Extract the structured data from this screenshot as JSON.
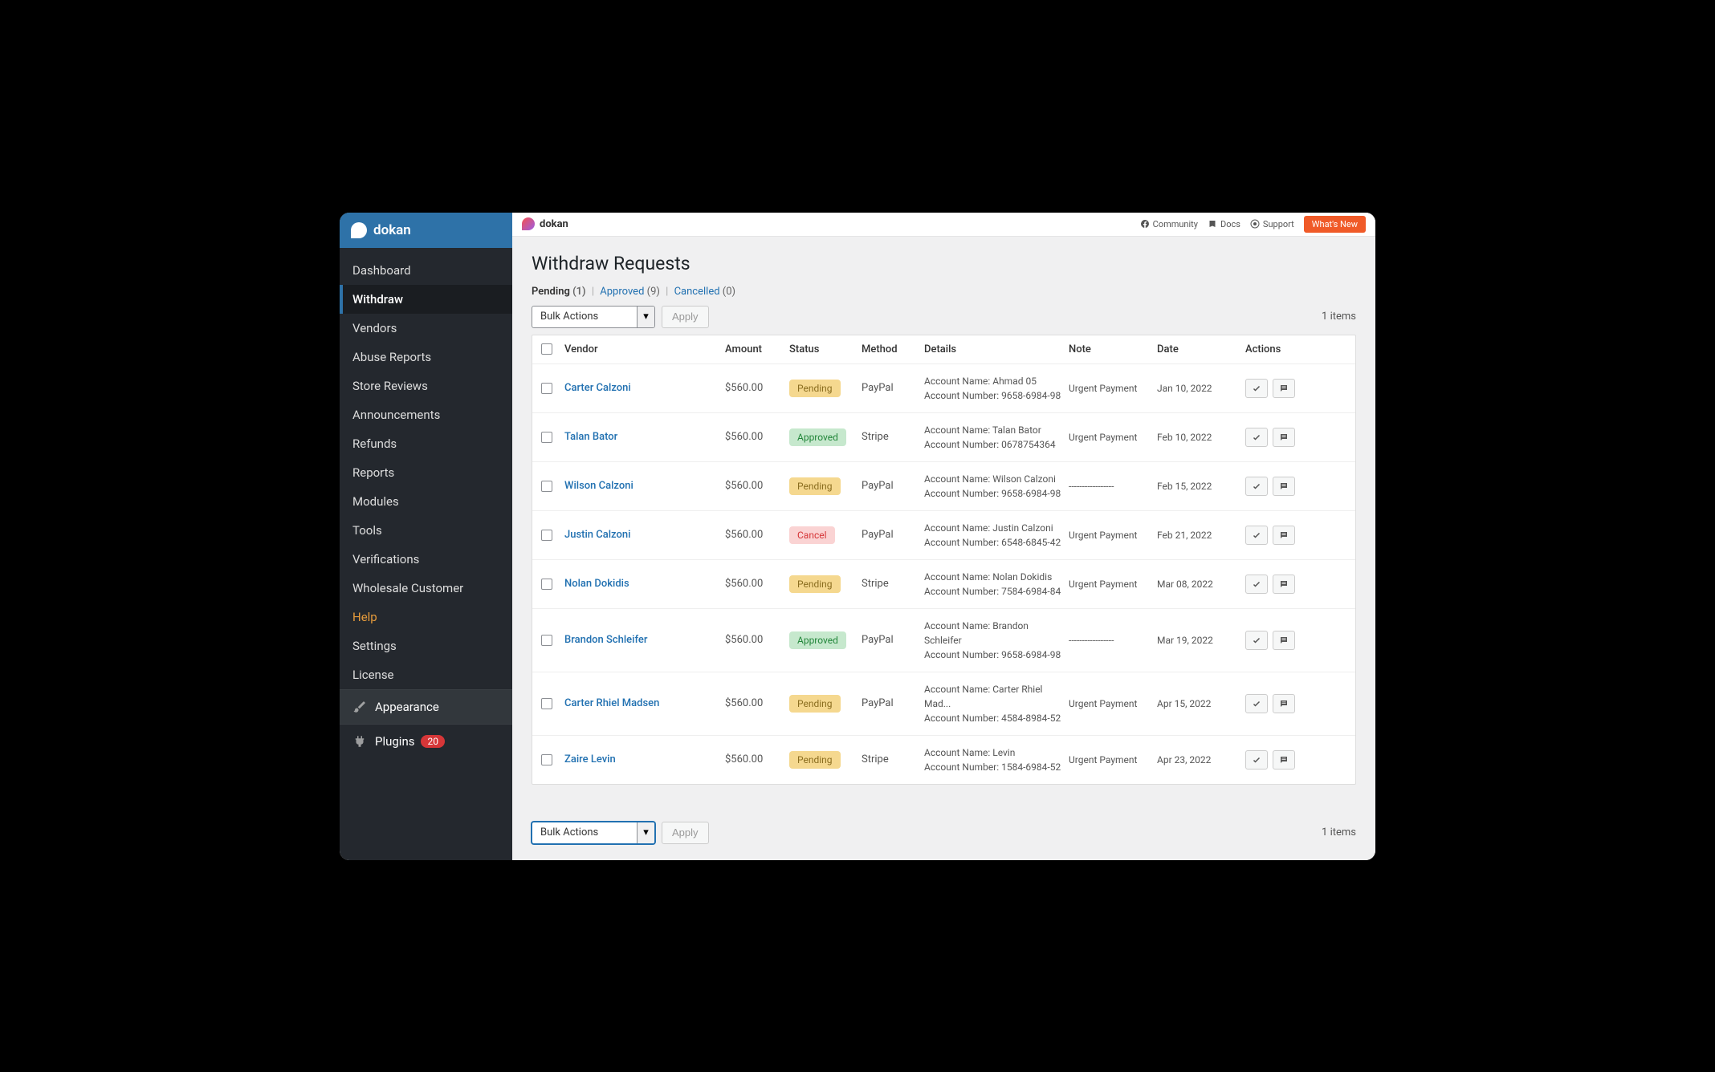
{
  "brand": "dokan",
  "sidebar": {
    "items": [
      {
        "label": "Dashboard"
      },
      {
        "label": "Withdraw"
      },
      {
        "label": "Vendors"
      },
      {
        "label": "Abuse Reports"
      },
      {
        "label": "Store Reviews"
      },
      {
        "label": "Announcements"
      },
      {
        "label": "Refunds"
      },
      {
        "label": "Reports"
      },
      {
        "label": "Modules"
      },
      {
        "label": "Tools"
      },
      {
        "label": "Verifications"
      },
      {
        "label": "Wholesale Customer"
      },
      {
        "label": "Help"
      },
      {
        "label": "Settings"
      },
      {
        "label": "License"
      }
    ],
    "appearance": "Appearance",
    "plugins": "Plugins",
    "plugins_count": "20"
  },
  "topbar": {
    "brand": "dokan",
    "community": "Community",
    "docs": "Docs",
    "support": "Support",
    "whats_new": "What's New"
  },
  "page": {
    "title": "Withdraw Requests",
    "tabs": {
      "pending": "Pending",
      "pending_count": "(1)",
      "approved": "Approved",
      "approved_count": "(9)",
      "cancelled": "Cancelled",
      "cancelled_count": "(0)"
    },
    "bulk_label": "Bulk Actions",
    "apply": "Apply",
    "items_count": "1 items"
  },
  "columns": {
    "vendor": "Vendor",
    "amount": "Amount",
    "status": "Status",
    "method": "Method",
    "details": "Details",
    "note": "Note",
    "date": "Date",
    "actions": "Actions"
  },
  "rows": [
    {
      "vendor": "Carter Calzoni",
      "amount": "$560.00",
      "status": "Pending",
      "status_class": "pending",
      "method": "PayPal",
      "acct_name": "Account Name: Ahmad 05",
      "acct_num": "Account Number: 9658-6984-98",
      "note": "Urgent Payment",
      "date": "Jan 10, 2022"
    },
    {
      "vendor": "Talan Bator",
      "amount": "$560.00",
      "status": "Approved",
      "status_class": "approved",
      "method": "Stripe",
      "acct_name": "Account Name: Talan Bator",
      "acct_num": "Account Number: 0678754364",
      "note": "Urgent Payment",
      "date": "Feb 10, 2022"
    },
    {
      "vendor": "Wilson Calzoni",
      "amount": "$560.00",
      "status": "Pending",
      "status_class": "pending",
      "method": "PayPal",
      "acct_name": "Account Name: Wilson Calzoni",
      "acct_num": "Account Number: 9658-6984-98",
      "note": "-----------------",
      "date": "Feb 15, 2022"
    },
    {
      "vendor": "Justin Calzoni",
      "amount": "$560.00",
      "status": "Cancel",
      "status_class": "cancel",
      "method": "PayPal",
      "acct_name": "Account Name: Justin Calzoni",
      "acct_num": "Account Number: 6548-6845-42",
      "note": "Urgent Payment",
      "date": "Feb 21, 2022"
    },
    {
      "vendor": "Nolan Dokidis",
      "amount": "$560.00",
      "status": "Pending",
      "status_class": "pending",
      "method": "Stripe",
      "acct_name": "Account Name: Nolan Dokidis",
      "acct_num": "Account Number: 7584-6984-84",
      "note": "Urgent Payment",
      "date": "Mar 08, 2022"
    },
    {
      "vendor": "Brandon Schleifer",
      "amount": "$560.00",
      "status": "Approved",
      "status_class": "approved",
      "method": "PayPal",
      "acct_name": "Account Name: Brandon Schleifer",
      "acct_num": "Account Number:  9658-6984-98",
      "note": "-----------------",
      "date": "Mar 19, 2022"
    },
    {
      "vendor": "Carter Rhiel Madsen",
      "amount": "$560.00",
      "status": "Pending",
      "status_class": "pending",
      "method": "PayPal",
      "acct_name": "Account Name: Carter Rhiel Mad...",
      "acct_num": "Account Number: 4584-8984-52",
      "note": "Urgent Payment",
      "date": "Apr 15, 2022"
    },
    {
      "vendor": "Zaire Levin",
      "amount": "$560.00",
      "status": "Pending",
      "status_class": "pending",
      "method": "Stripe",
      "acct_name": "Account Name: Levin",
      "acct_num": "Account Number: 1584-6984-52",
      "note": "Urgent Payment",
      "date": "Apr 23, 2022"
    }
  ]
}
